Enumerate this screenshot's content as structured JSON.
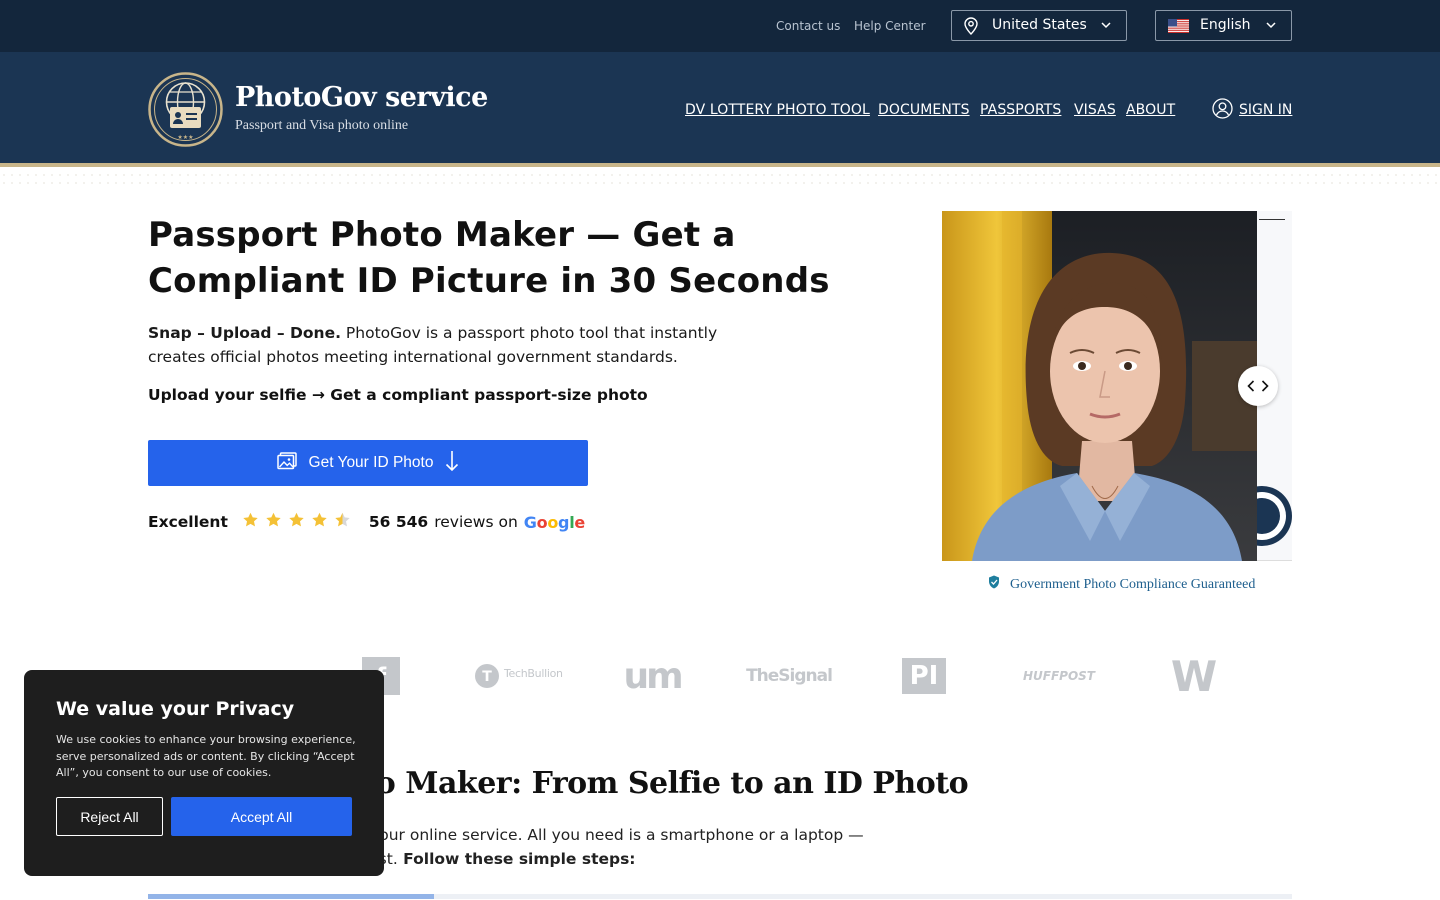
{
  "topbar": {
    "contact": "Contact us",
    "help": "Help Center",
    "country": "United States",
    "language": "English"
  },
  "header": {
    "brand_name": "PhotoGov service",
    "brand_sub": "Passport and Visa photo online",
    "nav": [
      "DV LOTTERY PHOTO TOOL",
      "DOCUMENTS",
      "PASSPORTS",
      "VISAS",
      "ABOUT"
    ],
    "signin": "SIGN IN"
  },
  "hero": {
    "title_bold": "Passport Photo Maker",
    "title_rest": " — Get a Compliant ID Picture in 30 Seconds",
    "desc_bold": "Snap – Upload – Done.",
    "desc_rest": " PhotoGov is a passport photo tool that instantly creates official photos meeting international government standards.",
    "upload_line": "Upload your selfie → Get a compliant passport-size photo",
    "cta": "Get Your ID Photo",
    "rating_label": "Excellent",
    "rating_stars": 4.5,
    "review_count": "56 546",
    "reviews_on": "reviews on",
    "google": "Google"
  },
  "carousel": {
    "guarantee": "Government Photo Compliance Guaranteed"
  },
  "press": [
    "",
    "",
    "TechBullion",
    "um",
    "TheSignal",
    "PI",
    "HUFFPOST",
    "W"
  ],
  "section": {
    "title": "Passport Photo Maker: From Selfie to an ID Photo",
    "body": "Create ID or Visa photos with our online service. All you need is a smartphone or a laptop — PhotoGov takes care of the rest.",
    "body_bold": " Follow these simple steps:",
    "progress": 0.25
  },
  "cookie": {
    "title": "We value your Privacy",
    "text": "We use cookies to enhance your browsing experience, serve personalized ads or content. By clicking “Accept All”, you consent to our use of cookies.",
    "reject": "Reject All",
    "accept": "Accept All"
  },
  "colors": {
    "topbar": "#13263c",
    "header": "#1b3553",
    "accent": "#2563eb",
    "gold": "#c8b58a",
    "star": "#f4c136"
  }
}
